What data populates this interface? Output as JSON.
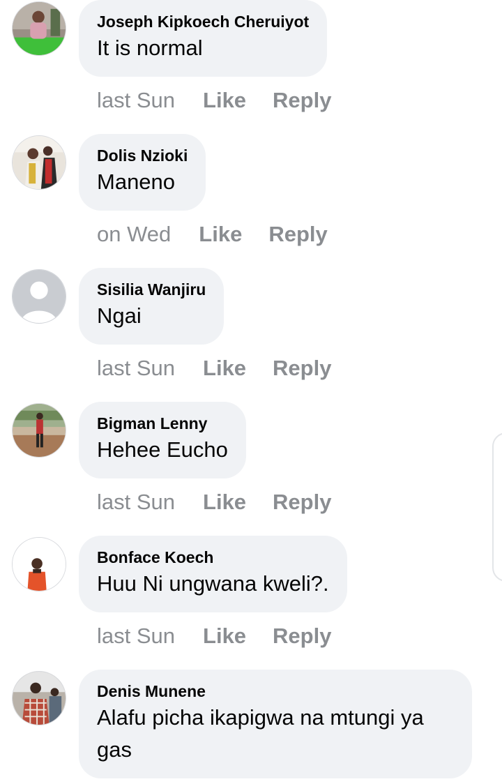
{
  "actions": {
    "like": "Like",
    "reply": "Reply"
  },
  "comments": [
    {
      "author": "Joseph Kipkoech Cheruiyot",
      "text": "It is normal",
      "time": "last Sun",
      "avatar_icon": "photo-avatar-icon"
    },
    {
      "author": "Dolis Nzioki",
      "text": "Maneno",
      "time": "on Wed",
      "avatar_icon": "photo-avatar-icon"
    },
    {
      "author": "Sisilia Wanjiru",
      "text": "Ngai",
      "time": "last Sun",
      "avatar_icon": "default-avatar-icon"
    },
    {
      "author": "Bigman Lenny",
      "text": "Hehee Eucho",
      "time": "last Sun",
      "avatar_icon": "photo-avatar-icon"
    },
    {
      "author": "Bonface Koech",
      "text": "Huu Ni ungwana kweli?.",
      "time": "last Sun",
      "avatar_icon": "photo-avatar-icon"
    },
    {
      "author": "Denis Munene",
      "text": "Alafu picha ikapigwa na mtungi ya gas",
      "time": "",
      "avatar_icon": "photo-avatar-icon"
    }
  ],
  "colors": {
    "bubble": "#f0f2f5",
    "meta": "#8a8d91",
    "text": "#050505"
  }
}
